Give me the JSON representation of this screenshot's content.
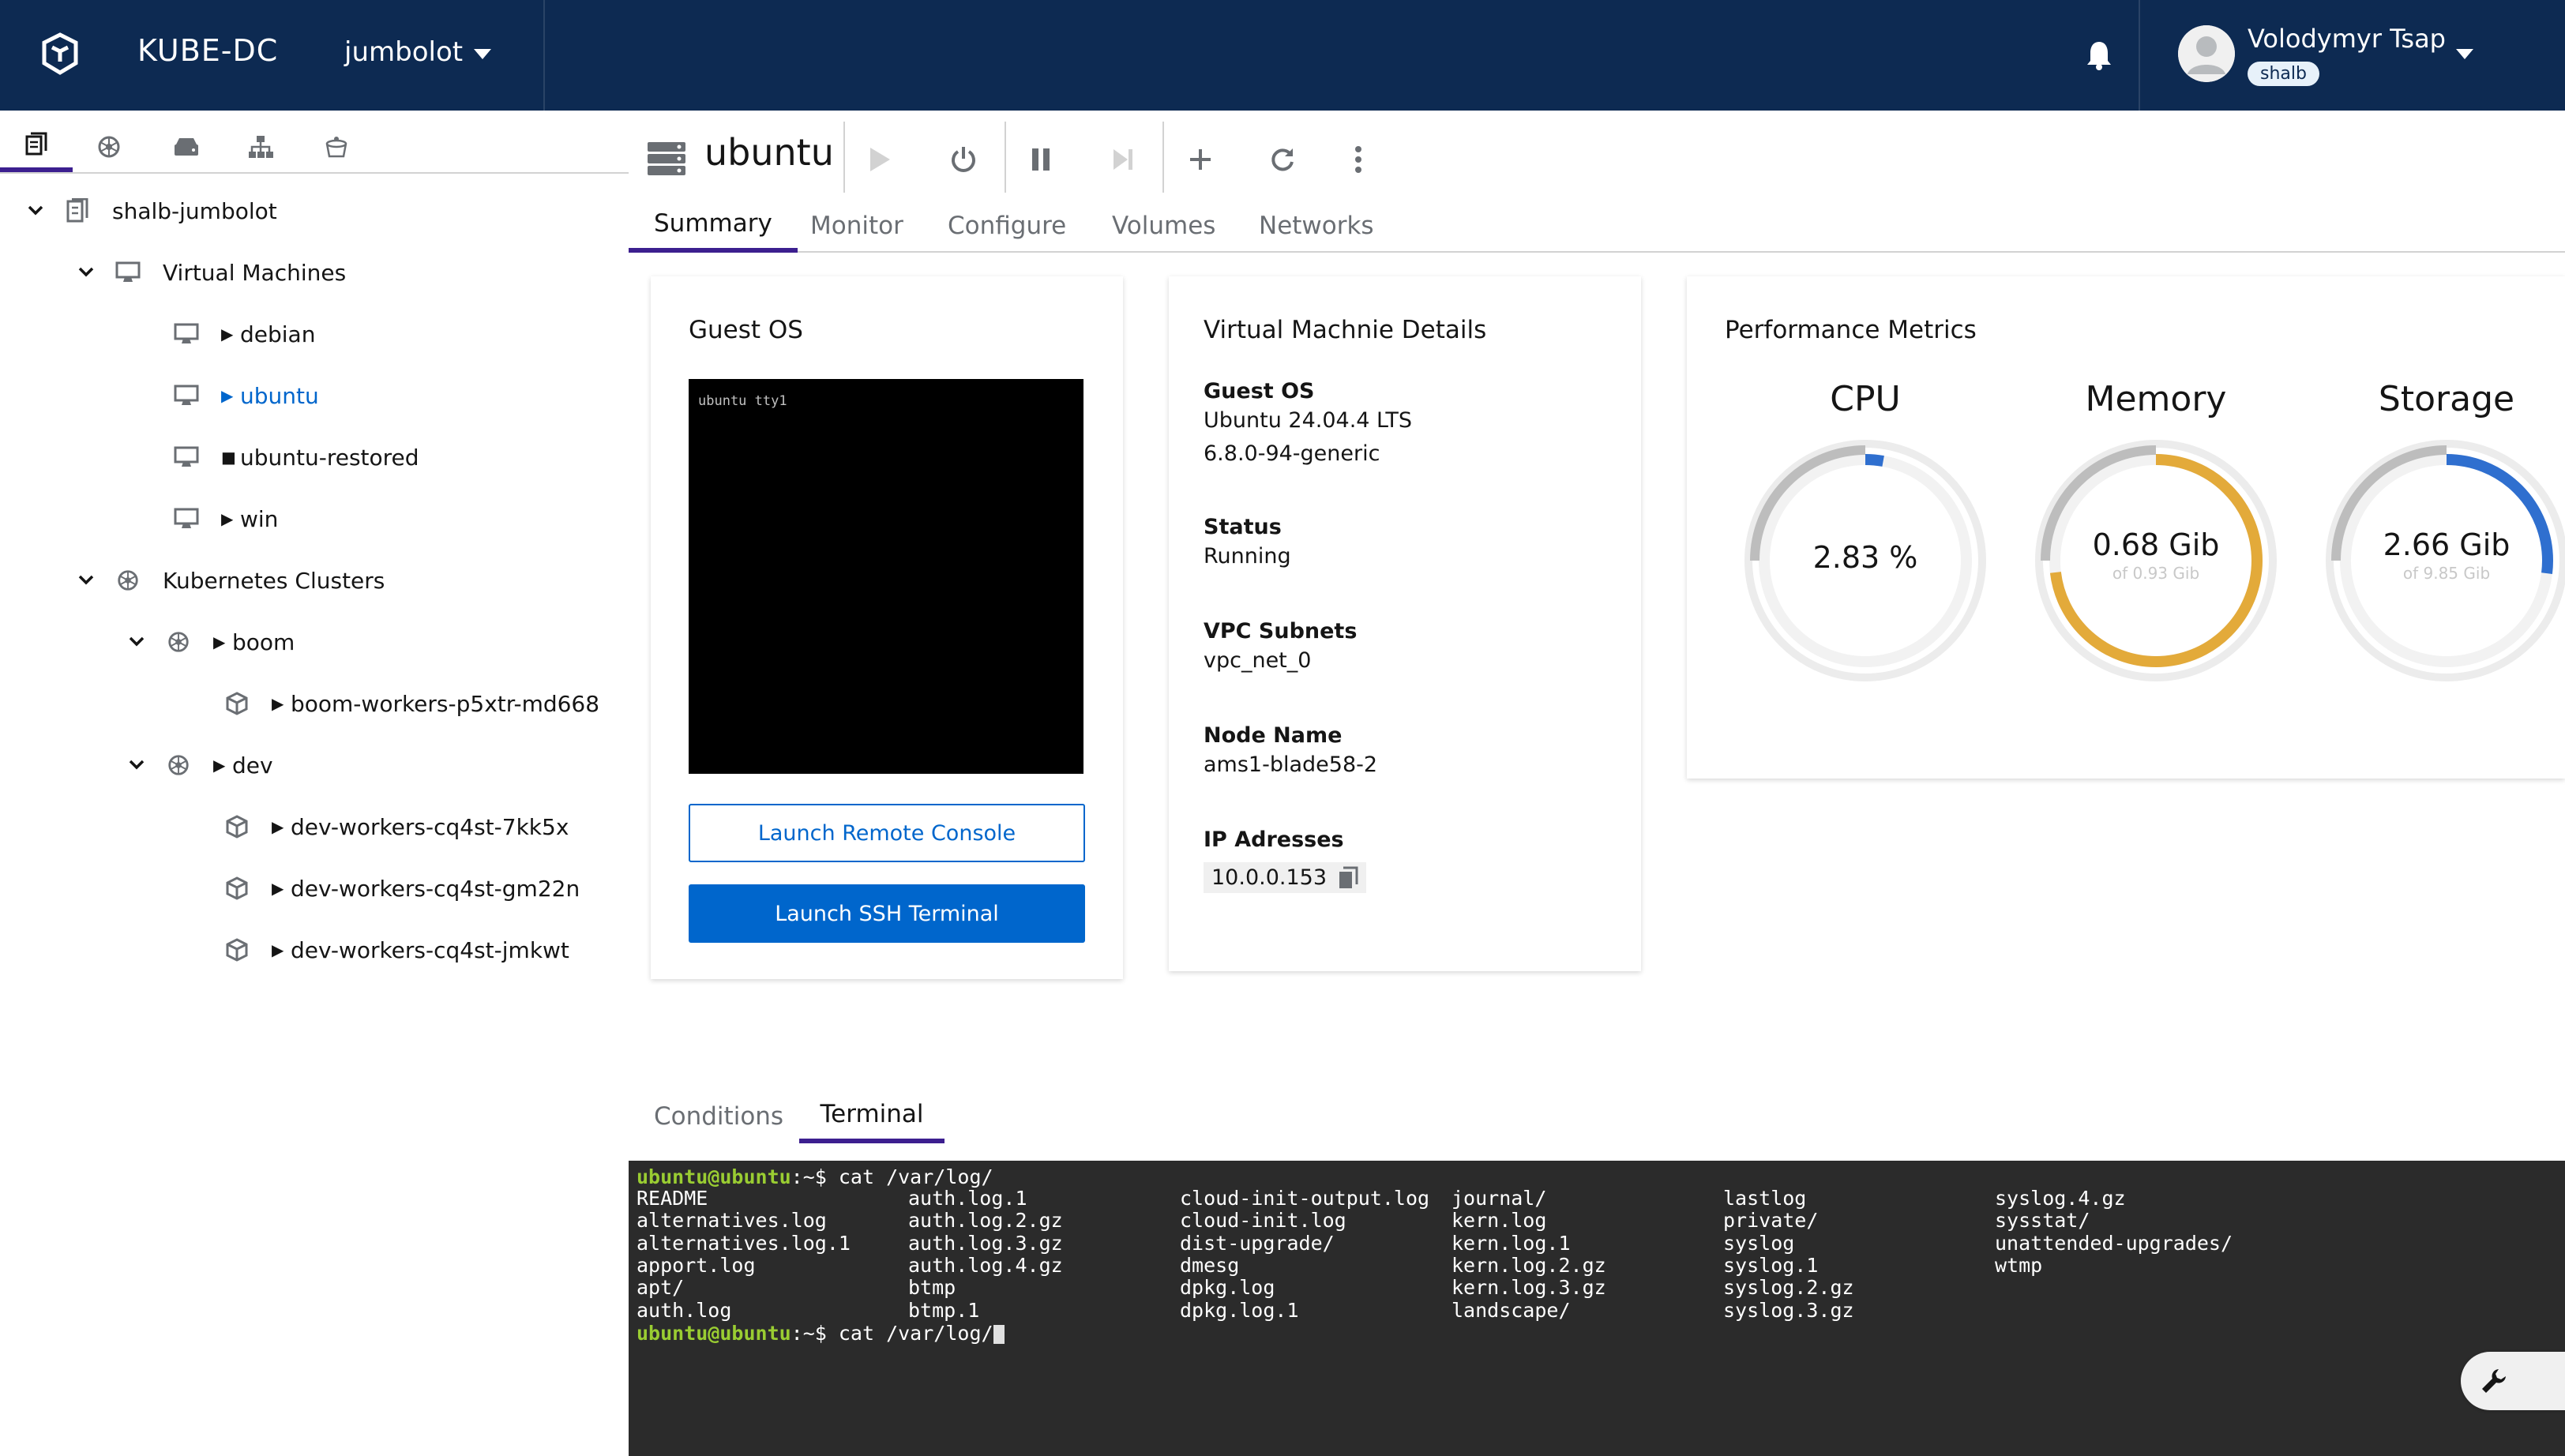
{
  "header": {
    "brand": "KUBE-DC",
    "project": "jumbolot",
    "user_name": "Volodymyr Tsap",
    "user_badge": "shalb"
  },
  "sidebar": {
    "tabs": [
      "documents-icon",
      "kubernetes-icon",
      "storage-icon",
      "network-icon",
      "bucket-icon"
    ],
    "tree": {
      "root": "shalb-jumbolot",
      "vm_group": "Virtual Machines",
      "vms": [
        {
          "name": "debian",
          "state": "running"
        },
        {
          "name": "ubuntu",
          "state": "running"
        },
        {
          "name": "ubuntu-restored",
          "state": "stopped"
        },
        {
          "name": "win",
          "state": "running"
        }
      ],
      "k8s_group": "Kubernetes Clusters",
      "clusters": [
        {
          "name": "boom",
          "workers": [
            "boom-workers-p5xtr-md668"
          ]
        },
        {
          "name": "dev",
          "workers": [
            "dev-workers-cq4st-7kk5x",
            "dev-workers-cq4st-gm22n",
            "dev-workers-cq4st-jmkwt"
          ]
        }
      ]
    }
  },
  "vm": {
    "title": "ubuntu",
    "tabs": [
      "Summary",
      "Monitor",
      "Configure",
      "Volumes",
      "Networks"
    ],
    "active_tab": "Summary"
  },
  "guest_os_card": {
    "title": "Guest OS",
    "console_text": "ubuntu tty1",
    "remote_console_label": "Launch Remote Console",
    "ssh_terminal_label": "Launch SSH Terminal"
  },
  "details_card": {
    "title": "Virtual Machnie Details",
    "guest_os_label": "Guest OS",
    "guest_os_line1": "Ubuntu 24.04.4 LTS",
    "guest_os_line2": "6.8.0-94-generic",
    "status_label": "Status",
    "status_value": "Running",
    "vpc_label": "VPC Subnets",
    "vpc_value": "vpc_net_0",
    "node_label": "Node Name",
    "node_value": "ams1-blade58-2",
    "ip_label": "IP Adresses",
    "ip_value": "10.0.0.153"
  },
  "metrics_card": {
    "title": "Performance Metrics",
    "gauges": [
      {
        "title": "CPU",
        "value": "2.83 %",
        "sub": "",
        "fraction": 0.0283,
        "color": "#2f6fcf"
      },
      {
        "title": "Memory",
        "value": "0.68 Gib",
        "sub": "of 0.93 Gib",
        "fraction": 0.731,
        "color": "#e3aa3a"
      },
      {
        "title": "Storage",
        "value": "2.66 Gib",
        "sub": "of 9.85 Gib",
        "fraction": 0.27,
        "color": "#2f6fcf"
      }
    ]
  },
  "bottom": {
    "tabs": [
      "Conditions",
      "Terminal"
    ],
    "active_tab": "Terminal"
  },
  "terminal": {
    "prompt": "ubuntu@ubuntu",
    "prompt_suffix": ":~$",
    "command": " cat /var/log/",
    "columns": [
      [
        "README",
        "alternatives.log",
        "alternatives.log.1",
        "apport.log",
        "apt/",
        "auth.log"
      ],
      [
        "auth.log.1",
        "auth.log.2.gz",
        "auth.log.3.gz",
        "auth.log.4.gz",
        "btmp",
        "btmp.1"
      ],
      [
        "cloud-init-output.log",
        "cloud-init.log",
        "dist-upgrade/",
        "dmesg",
        "dpkg.log",
        "dpkg.log.1"
      ],
      [
        "journal/",
        "kern.log",
        "kern.log.1",
        "kern.log.2.gz",
        "kern.log.3.gz",
        "landscape/"
      ],
      [
        "lastlog",
        "private/",
        "syslog",
        "syslog.1",
        "syslog.2.gz",
        "syslog.3.gz"
      ],
      [
        "syslog.4.gz",
        "sysstat/",
        "unattended-upgrades/",
        "wtmp"
      ]
    ],
    "current_input": " cat /var/log/"
  }
}
